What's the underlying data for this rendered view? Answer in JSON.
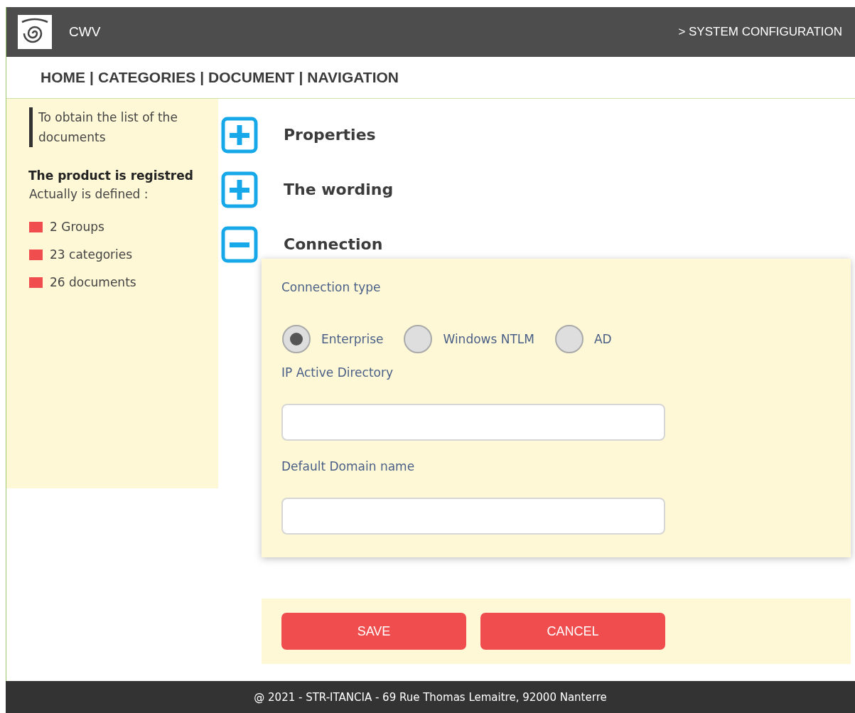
{
  "header": {
    "title": "CWV",
    "breadcrumb": "> SYSTEM CONFIGURATION"
  },
  "nav": [
    "HOME",
    "CATEGORIES",
    "DOCUMENT",
    "NAVIGATION"
  ],
  "nav_separator": "|",
  "sidebar": {
    "hint": "To obtain the list of the documents",
    "status": "The product is registred",
    "subtitle": "Actually is defined :",
    "items": [
      {
        "label": "2 Groups",
        "color": "#f04e4e"
      },
      {
        "label": "23 categories",
        "color": "#f04e4e"
      },
      {
        "label": "26 documents",
        "color": "#f04e4e"
      }
    ]
  },
  "sections": [
    {
      "title": "Properties",
      "expanded": false
    },
    {
      "title": "The wording",
      "expanded": false
    },
    {
      "title": "Connection",
      "expanded": true
    }
  ],
  "connection": {
    "type_label": "Connection type",
    "options": [
      {
        "label": "Enterprise",
        "selected": true
      },
      {
        "label": "Windows NTLM",
        "selected": false
      },
      {
        "label": "AD",
        "selected": false
      }
    ],
    "fields": [
      {
        "label": "IP Active Directory"
      },
      {
        "label": "Default Domain name"
      }
    ]
  },
  "buttons": [
    "SAVE",
    "CANCEL"
  ],
  "footer": "@ 2021 - STR-ITANCIA - 69 Rue Thomas Lemaitre, 92000 Nanterre"
}
